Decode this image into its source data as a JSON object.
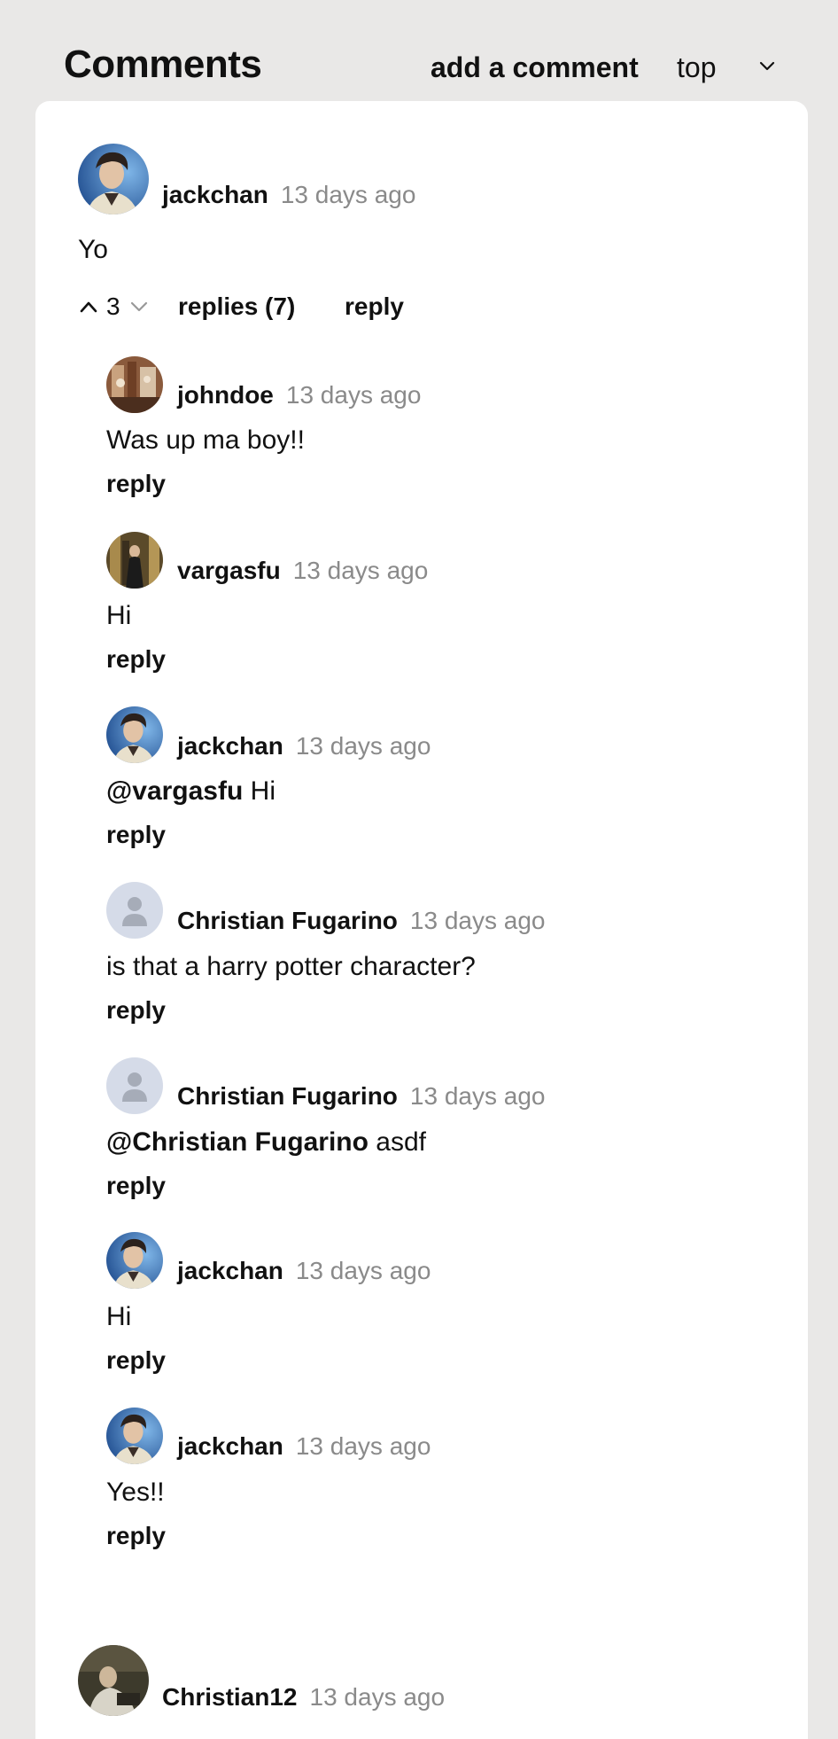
{
  "header": {
    "title": "Comments",
    "add_comment_label": "add a comment",
    "sort": {
      "selected": "top"
    }
  },
  "comments": [
    {
      "author": "jackchan",
      "time": "13 days ago",
      "text": "Yo",
      "votes": "3",
      "replies_label": "replies (7)",
      "reply_label": "reply",
      "replies": [
        {
          "author": "johndoe",
          "time": "13 days ago",
          "mention": "",
          "text": "Was up ma boy!!",
          "reply_label": "reply"
        },
        {
          "author": "vargasfu",
          "time": "13 days ago",
          "mention": "",
          "text": "Hi",
          "reply_label": "reply"
        },
        {
          "author": "jackchan",
          "time": "13 days ago",
          "mention": "@vargasfu",
          "text": "Hi",
          "reply_label": "reply"
        },
        {
          "author": "Christian Fugarino",
          "time": "13 days ago",
          "mention": "",
          "text": "is that a harry potter character?",
          "reply_label": "reply"
        },
        {
          "author": "Christian Fugarino",
          "time": "13 days ago",
          "mention": "@Christian Fugarino",
          "text": "asdf",
          "reply_label": "reply"
        },
        {
          "author": "jackchan",
          "time": "13 days ago",
          "mention": "",
          "text": "Hi",
          "reply_label": "reply"
        },
        {
          "author": "jackchan",
          "time": "13 days ago",
          "mention": "",
          "text": "Yes!!",
          "reply_label": "reply"
        }
      ]
    },
    {
      "author": "Christian12",
      "time": "13 days ago"
    }
  ],
  "icons": {
    "upvote": "chevron-up-icon",
    "downvote": "chevron-down-icon",
    "sort": "chevron-down-icon",
    "placeholder_avatar": "user-silhouette-icon"
  },
  "colors": {
    "page_bg": "#e9e8e7",
    "card_bg": "#ffffff",
    "muted_text": "#8a8a8a",
    "placeholder_avatar": "#d5dbe8"
  }
}
